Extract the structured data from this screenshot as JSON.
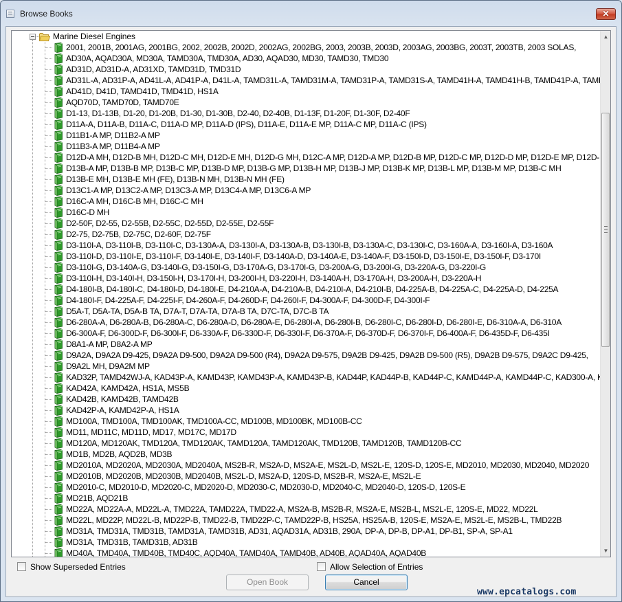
{
  "window": {
    "title": "Browse Books",
    "close_glyph": "✕"
  },
  "tree": {
    "root_label": "Marine Diesel Engines",
    "items": [
      "2001, 2001B, 2001AG, 2001BG, 2002, 2002B, 2002D, 2002AG, 2002BG, 2003, 2003B, 2003D, 2003AG, 2003BG, 2003T, 2003TB, 2003 SOLAS,",
      "AD30A, AQAD30A, MD30A, TAMD30A, TMD30A, AD30, AQAD30, MD30, TAMD30, TMD30",
      "AD31D, AD31D-A, AD31XD, TAMD31D, TMD31D",
      "AD31L-A, AD31P-A, AD41L-A, AD41P-A, D41L-A, TAMD31L-A, TAMD31M-A, TAMD31P-A, TAMD31S-A, TAMD41H-A, TAMD41H-B, TAMD41P-A, TAMD41L",
      "AD41D, D41D, TAMD41D, TMD41D, HS1A",
      "AQD70D, TAMD70D, TAMD70E",
      "D1-13, D1-13B, D1-20, D1-20B, D1-30, D1-30B, D2-40, D2-40B, D1-13F, D1-20F, D1-30F, D2-40F",
      "D11A-A, D11A-B, D11A-C, D11A-D MP, D11A-D (IPS), D11A-E, D11A-E MP, D11A-C MP, D11A-C (IPS)",
      "D11B1-A MP, D11B2-A MP",
      "D11B3-A MP, D11B4-A MP",
      "D12D-A MH, D12D-B MH, D12D-C MH, D12D-E MH, D12D-G MH, D12C-A MP, D12D-A MP, D12D-B MP, D12D-C MP, D12D-D MP, D12D-E MP, D12D-F",
      "D13B-A MP, D13B-B MP, D13B-C MP, D13B-D MP, D13B-G MP, D13B-H MP, D13B-J MP, D13B-K MP, D13B-L MP, D13B-M MP, D13B-C MH",
      "D13B-E MH, D13B-E MH (FE), D13B-N MH, D13B-N MH (FE)",
      "D13C1-A MP, D13C2-A MP, D13C3-A MP, D13C4-A MP, D13C6-A MP",
      "D16C-A MH, D16C-B MH, D16C-C MH",
      "D16C-D MH",
      "D2-50F, D2-55, D2-55B, D2-55C, D2-55D, D2-55E, D2-55F",
      "D2-75, D2-75B, D2-75C, D2-60F, D2-75F",
      "D3-110I-A, D3-110I-B, D3-110I-C, D3-130A-A, D3-130I-A, D3-130A-B, D3-130I-B, D3-130A-C, D3-130I-C, D3-160A-A, D3-160I-A, D3-160A",
      "D3-110I-D, D3-110I-E, D3-110I-F, D3-140I-E, D3-140I-F, D3-140A-D, D3-140A-E, D3-140A-F, D3-150I-D, D3-150I-E, D3-150I-F, D3-170I",
      "D3-110I-G, D3-140A-G, D3-140I-G, D3-150I-G, D3-170A-G, D3-170I-G, D3-200A-G, D3-200I-G, D3-220A-G, D3-220I-G",
      "D3-110I-H, D3-140I-H, D3-150I-H, D3-170I-H, D3-200I-H, D3-220I-H, D3-140A-H, D3-170A-H, D3-200A-H, D3-220A-H",
      "D4-180I-B, D4-180I-C, D4-180I-D, D4-180I-E, D4-210A-A, D4-210A-B, D4-210I-A, D4-210I-B, D4-225A-B, D4-225A-C, D4-225A-D, D4-225A",
      "D4-180I-F, D4-225A-F, D4-225I-F, D4-260A-F, D4-260D-F, D4-260I-F, D4-300A-F, D4-300D-F, D4-300I-F",
      "D5A-T, D5A-TA, D5A-B TA, D7A-T, D7A-TA, D7A-B TA, D7C-TA, D7C-B TA",
      "D6-280A-A, D6-280A-B, D6-280A-C, D6-280A-D, D6-280A-E, D6-280I-A, D6-280I-B, D6-280I-C, D6-280I-D, D6-280I-E, D6-310A-A, D6-310A",
      "D6-300A-F, D6-300D-F, D6-300I-F, D6-330A-F, D6-330D-F, D6-330I-F, D6-370A-F, D6-370D-F, D6-370I-F, D6-400A-F, D6-435D-F, D6-435I",
      "D8A1-A MP, D8A2-A MP",
      "D9A2A, D9A2A D9-425, D9A2A D9-500, D9A2A D9-500 (R4), D9A2A D9-575, D9A2B D9-425, D9A2B D9-500 (R5), D9A2B D9-575, D9A2C D9-425,",
      "D9A2L MH, D9A2M MP",
      "KAD32P, TAMD42WJ-A, KAD43P-A, KAMD43P, KAMD43P-A, KAMD43P-B, KAD44P, KAD44P-B, KAD44P-C, KAMD44P-A, KAMD44P-C, KAD300-A, KAMD300",
      "KAD42A, KAMD42A, HS1A, MS5B",
      "KAD42B, KAMD42B, TAMD42B",
      "KAD42P-A, KAMD42P-A, HS1A",
      "MD100A, TMD100A, TMD100AK, TMD100A-CC, MD100B, MD100BK, MD100B-CC",
      "MD11, MD11C, MD11D, MD17, MD17C, MD17D",
      "MD120A, MD120AK, TMD120A, TMD120AK, TAMD120A, TAMD120AK, TMD120B, TAMD120B, TAMD120B-CC",
      "MD1B, MD2B, AQD2B, MD3B",
      "MD2010A, MD2020A, MD2030A, MD2040A, MS2B-R, MS2A-D, MS2A-E, MS2L-D, MS2L-E, 120S-D, 120S-E, MD2010, MD2030, MD2040, MD2020",
      "MD2010B, MD2020B, MD2030B, MD2040B, MS2L-D, MS2A-D, 120S-D, MS2B-R, MS2A-E, MS2L-E",
      "MD2010-C, MD2010-D, MD2020-C, MD2020-D, MD2030-C, MD2030-D, MD2040-C, MD2040-D, 120S-D, 120S-E",
      "MD21B, AQD21B",
      "MD22A, MD22A-A, MD22L-A, TMD22A, TAMD22A, TMD22-A, MS2A-B, MS2B-R, MS2A-E, MS2B-L, MS2L-E, 120S-E, MD22, MD22L",
      "MD22L, MD22P, MD22L-B, MD22P-B, TMD22-B, TMD22P-C, TAMD22P-B, HS25A, HS25A-B, 120S-E, MS2A-E, MS2L-E, MS2B-L, TMD22B",
      "MD31A, TMD31A, TMD31B, TAMD31A, TAMD31B, AD31, AQAD31A, AD31B, 290A, DP-A, DP-B, DP-A1, DP-B1, SP-A, SP-A1",
      "MD31A, TMD31B, TAMD31B, AD31B",
      "MD40A, TMD40A, TMD40B, TMD40C, AQD40A, TAMD40A, TAMD40B, AD40B, AQAD40A, AQAD40B"
    ]
  },
  "options": {
    "show_superseded_label": "Show Superseded Entries",
    "allow_selection_label": "Allow Selection of Entries"
  },
  "buttons": {
    "open_book": "Open Book",
    "cancel": "Cancel"
  },
  "watermark": "www.epcatalogs.com",
  "colors": {
    "book_green": "#2e9a2a",
    "folder_yellow": "#f0cf5a",
    "close_red": "#c9432a"
  }
}
